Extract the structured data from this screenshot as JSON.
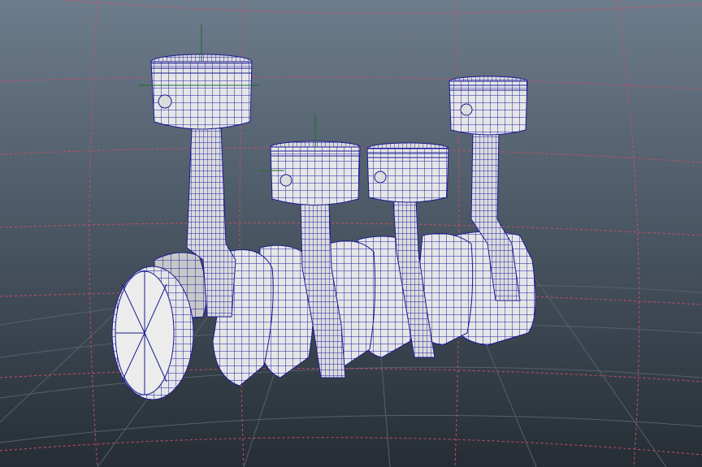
{
  "viewport": {
    "background_top": "#6b7a8a",
    "background_bottom": "#2b333b",
    "grid_color": "#55606b",
    "boundary_color": "#d0506a",
    "wire_color": "#1a1aa0",
    "surface_color": "#e8e8e8"
  }
}
